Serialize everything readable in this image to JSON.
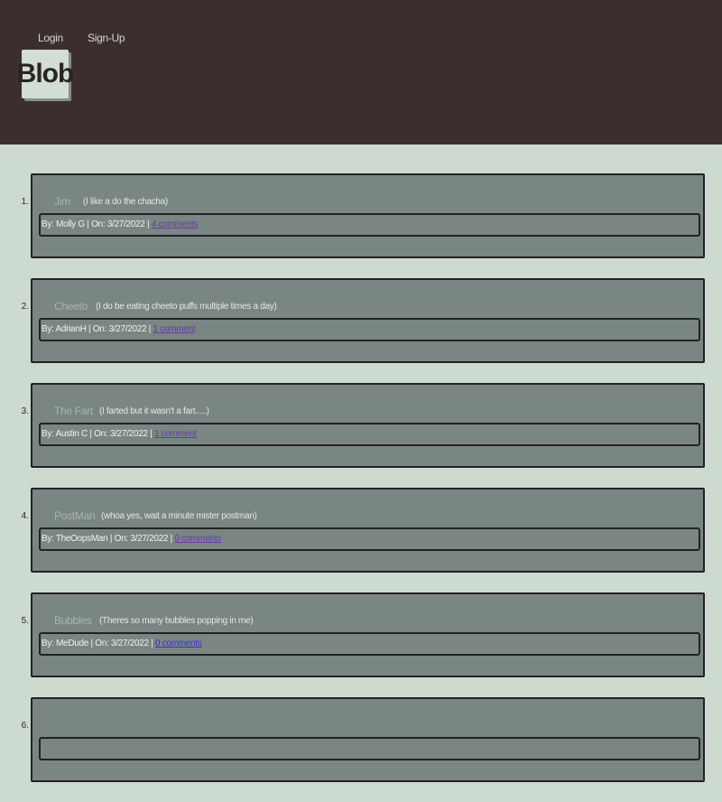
{
  "nav": {
    "login": "Login",
    "signup": "Sign-Up"
  },
  "logo": "Blob",
  "posts": [
    {
      "number": "1.",
      "title": "Jim",
      "body": "(I like a do the chacha)",
      "meta": "By: Molly G | On: 3/27/2022 | ",
      "comments": "4 comments"
    },
    {
      "number": "2.",
      "title": "Cheeto",
      "body": "(I do be eating cheeto puffs multiple times a day)",
      "meta": "By: AdrianH | On: 3/27/2022 | ",
      "comments": "1 comment"
    },
    {
      "number": "3.",
      "title": "The Fart",
      "body": "(I farted but it wasn't a fart.....)",
      "meta": "By: Austin C | On: 3/27/2022 | ",
      "comments": "1 comment"
    },
    {
      "number": "4.",
      "title": "PostMan",
      "body": "(whoa yes, wait a minute mister postman)",
      "meta": "By: TheOopsMan | On: 3/27/2022 | ",
      "comments": "0 comments"
    },
    {
      "number": "5.",
      "title": "Bubbles",
      "body": "(Theres so many bubbles popping in me)",
      "meta": "By: MeDude | On: 3/27/2022 | ",
      "comments": "0 comments"
    },
    {
      "number": "6.",
      "title": "",
      "body": "",
      "meta": "",
      "comments": ""
    }
  ],
  "colors": {
    "header_bg": "#3a2f2e",
    "page_bg": "#cddad0",
    "card_bg": "#7a8683",
    "link_unvisited": "#3a2fd8",
    "link_visited": "#6a3aa5"
  }
}
